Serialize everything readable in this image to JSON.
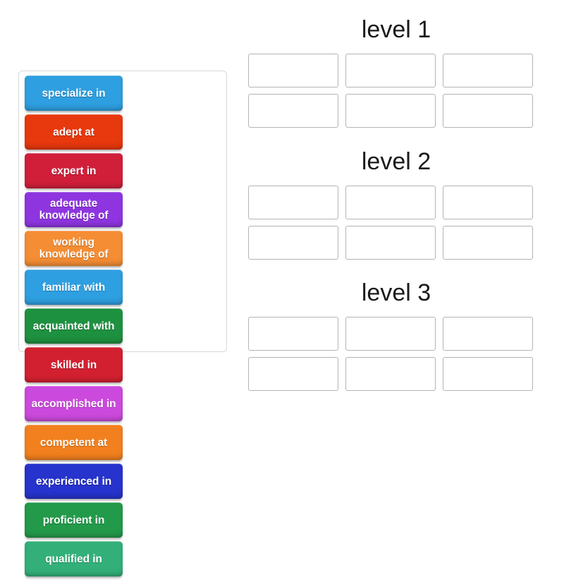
{
  "activity": {
    "type": "drag-and-drop word sort"
  },
  "word_bank": {
    "tiles": [
      {
        "label": "specialize in",
        "color": "#2e9fe0"
      },
      {
        "label": "adept at",
        "color": "#e8380d"
      },
      {
        "label": "expert in",
        "color": "#d11f3a"
      },
      {
        "label": "adequate knowledge of",
        "color": "#8e35e0"
      },
      {
        "label": "working knowledge of",
        "color": "#f58d34"
      },
      {
        "label": "familiar with",
        "color": "#2e9fe0"
      },
      {
        "label": "acquainted with",
        "color": "#1e9140"
      },
      {
        "label": "skilled in",
        "color": "#d32030"
      },
      {
        "label": "accomplished in",
        "color": "#cc49dd"
      },
      {
        "label": "competent at",
        "color": "#f2801e"
      },
      {
        "label": "experienced in",
        "color": "#2633cc"
      },
      {
        "label": "proficient in",
        "color": "#229a4a"
      },
      {
        "label": "qualified in",
        "color": "#33b07a"
      }
    ]
  },
  "levels": [
    {
      "title": "level 1",
      "slots": [
        "",
        "",
        "",
        "",
        "",
        ""
      ]
    },
    {
      "title": "level 2",
      "slots": [
        "",
        "",
        "",
        "",
        "",
        ""
      ]
    },
    {
      "title": "level 3",
      "slots": [
        "",
        "",
        "",
        "",
        "",
        ""
      ]
    }
  ]
}
